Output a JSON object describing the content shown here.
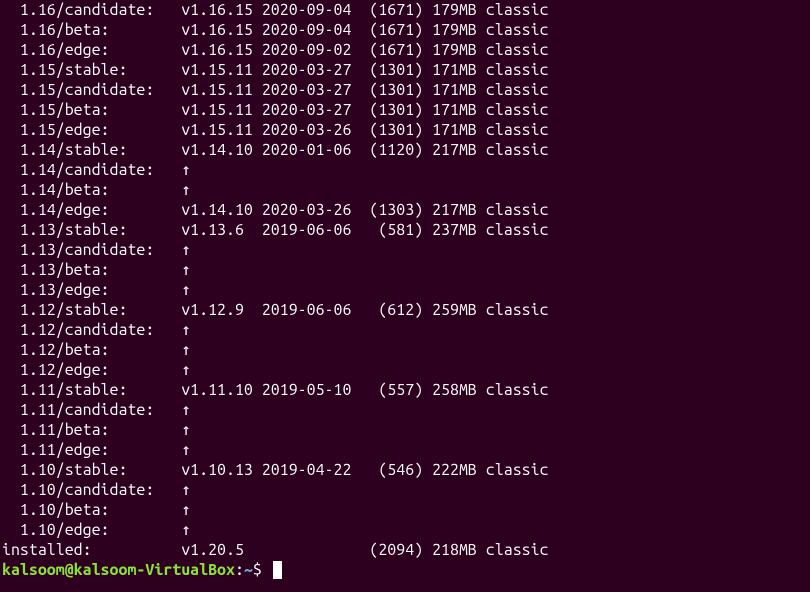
{
  "rows": [
    {
      "channel": "  1.16/candidate:",
      "version": "v1.16.15",
      "date": "2020-09-04",
      "rev": "(1671)",
      "size": "179MB",
      "notes": "classic"
    },
    {
      "channel": "  1.16/beta:",
      "version": "v1.16.15",
      "date": "2020-09-04",
      "rev": "(1671)",
      "size": "179MB",
      "notes": "classic"
    },
    {
      "channel": "  1.16/edge:",
      "version": "v1.16.15",
      "date": "2020-09-02",
      "rev": "(1671)",
      "size": "179MB",
      "notes": "classic"
    },
    {
      "channel": "  1.15/stable:",
      "version": "v1.15.11",
      "date": "2020-03-27",
      "rev": "(1301)",
      "size": "171MB",
      "notes": "classic"
    },
    {
      "channel": "  1.15/candidate:",
      "version": "v1.15.11",
      "date": "2020-03-27",
      "rev": "(1301)",
      "size": "171MB",
      "notes": "classic"
    },
    {
      "channel": "  1.15/beta:",
      "version": "v1.15.11",
      "date": "2020-03-27",
      "rev": "(1301)",
      "size": "171MB",
      "notes": "classic"
    },
    {
      "channel": "  1.15/edge:",
      "version": "v1.15.11",
      "date": "2020-03-26",
      "rev": "(1301)",
      "size": "171MB",
      "notes": "classic"
    },
    {
      "channel": "  1.14/stable:",
      "version": "v1.14.10",
      "date": "2020-01-06",
      "rev": "(1120)",
      "size": "217MB",
      "notes": "classic"
    },
    {
      "channel": "  1.14/candidate:",
      "arrow": "↑"
    },
    {
      "channel": "  1.14/beta:",
      "arrow": "↑"
    },
    {
      "channel": "  1.14/edge:",
      "version": "v1.14.10",
      "date": "2020-03-26",
      "rev": "(1303)",
      "size": "217MB",
      "notes": "classic"
    },
    {
      "channel": "  1.13/stable:",
      "version": "v1.13.6",
      "date": "2019-06-06",
      "rev": " (581)",
      "size": "237MB",
      "notes": "classic"
    },
    {
      "channel": "  1.13/candidate:",
      "arrow": "↑"
    },
    {
      "channel": "  1.13/beta:",
      "arrow": "↑"
    },
    {
      "channel": "  1.13/edge:",
      "arrow": "↑"
    },
    {
      "channel": "  1.12/stable:",
      "version": "v1.12.9",
      "date": "2019-06-06",
      "rev": " (612)",
      "size": "259MB",
      "notes": "classic"
    },
    {
      "channel": "  1.12/candidate:",
      "arrow": "↑"
    },
    {
      "channel": "  1.12/beta:",
      "arrow": "↑"
    },
    {
      "channel": "  1.12/edge:",
      "arrow": "↑"
    },
    {
      "channel": "  1.11/stable:",
      "version": "v1.11.10",
      "date": "2019-05-10",
      "rev": " (557)",
      "size": "258MB",
      "notes": "classic"
    },
    {
      "channel": "  1.11/candidate:",
      "arrow": "↑"
    },
    {
      "channel": "  1.11/beta:",
      "arrow": "↑"
    },
    {
      "channel": "  1.11/edge:",
      "arrow": "↑"
    },
    {
      "channel": "  1.10/stable:",
      "version": "v1.10.13",
      "date": "2019-04-22",
      "rev": " (546)",
      "size": "222MB",
      "notes": "classic"
    },
    {
      "channel": "  1.10/candidate:",
      "arrow": "↑"
    },
    {
      "channel": "  1.10/beta:",
      "arrow": "↑"
    },
    {
      "channel": "  1.10/edge:",
      "arrow": "↑"
    },
    {
      "channel": "installed:",
      "version": "v1.20.5",
      "date": "",
      "rev": "(2094)",
      "size": "218MB",
      "notes": "classic"
    }
  ],
  "columns": {
    "channel_width": 20,
    "version_width": 9,
    "date_width": 11,
    "rev_width": 7,
    "size_width": 6
  },
  "prompt": {
    "user_host": "kalsoom@kalsoom-VirtualBox",
    "sep": ":",
    "path": "~",
    "dollar": "$ "
  }
}
